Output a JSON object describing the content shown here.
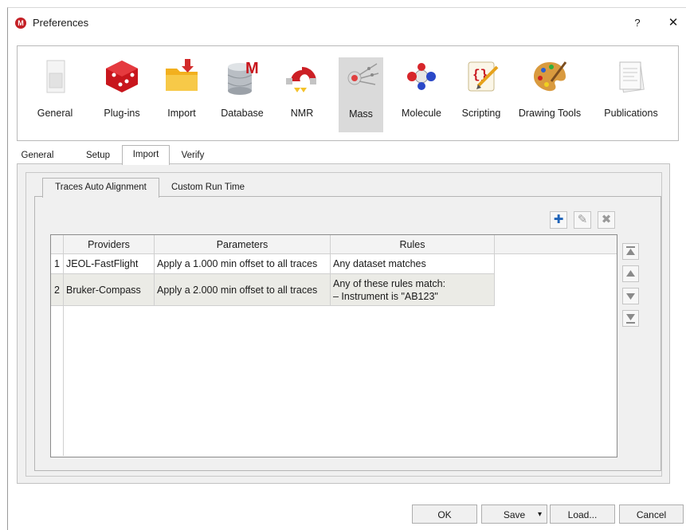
{
  "window": {
    "title": "Preferences",
    "help_label": "?",
    "close_label": "✕"
  },
  "toolbar": {
    "items": [
      {
        "label": "General",
        "icon": "general-icon"
      },
      {
        "label": "Plug-ins",
        "icon": "plugins-icon"
      },
      {
        "label": "Import",
        "icon": "import-folder-icon"
      },
      {
        "label": "Database",
        "icon": "database-icon"
      },
      {
        "label": "NMR",
        "icon": "nmr-magnet-icon"
      },
      {
        "label": "Mass",
        "icon": "mass-icon",
        "selected": true
      },
      {
        "label": "Molecule",
        "icon": "molecule-icon"
      },
      {
        "label": "Scripting",
        "icon": "scripting-scroll-icon"
      },
      {
        "label": "Drawing Tools",
        "icon": "palette-icon"
      },
      {
        "label": "Publications",
        "icon": "publications-icon"
      }
    ]
  },
  "tabs": [
    {
      "label": "General"
    },
    {
      "label": "Setup"
    },
    {
      "label": "Import",
      "active": true
    },
    {
      "label": "Verify"
    }
  ],
  "subtabs": [
    {
      "label": "Traces Auto Alignment",
      "active": true
    },
    {
      "label": "Custom Run Time"
    }
  ],
  "actions": {
    "add_icon": "plus-icon",
    "edit_icon": "pencil-icon",
    "remove_icon": "x-icon"
  },
  "table": {
    "columns": [
      "Providers",
      "Parameters",
      "Rules"
    ],
    "rows": [
      {
        "num": "1",
        "provider": "JEOL-FastFlight",
        "parameters": "Apply a 1.000 min offset to all traces",
        "rules": [
          "Any dataset matches"
        ]
      },
      {
        "num": "2",
        "provider": "Bruker-Compass",
        "parameters": "Apply a 2.000 min offset to all traces",
        "rules": [
          "Any of these rules match:",
          "– Instrument is \"AB123\""
        ]
      }
    ]
  },
  "move_buttons": [
    "move-top-icon",
    "move-up-icon",
    "move-down-icon",
    "move-bottom-icon"
  ],
  "footer": {
    "ok": "OK",
    "save": "Save",
    "save_arrow": "▾",
    "load": "Load...",
    "cancel": "Cancel"
  },
  "colors": {
    "accent_blue": "#1f63b8",
    "app_red": "#c42026",
    "selected_tool_bg": "#dadada"
  }
}
